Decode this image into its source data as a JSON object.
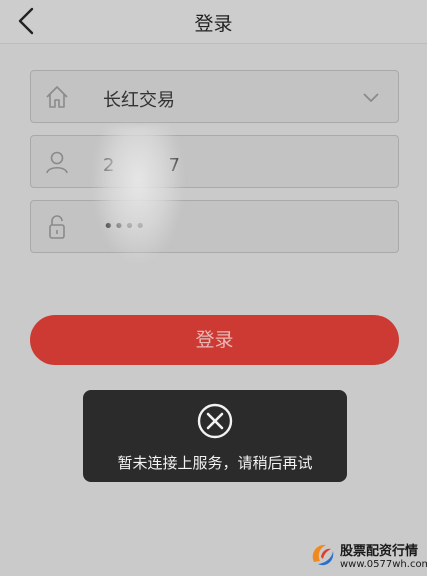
{
  "header": {
    "title": "登录"
  },
  "form": {
    "broker": {
      "value": "长红交易"
    },
    "account": {
      "value": "2　　　7"
    },
    "password": {
      "value": "••••"
    }
  },
  "login_button": {
    "label": "登录"
  },
  "toast": {
    "message": "暂未连接上服务，请稍后再试"
  },
  "watermark": {
    "title": "股票配资行情",
    "url": "www.0577wh.com"
  },
  "icons": {
    "back": "chevron-left-icon",
    "broker": "home-icon",
    "account": "user-icon",
    "password": "lock-icon",
    "dropdown": "chevron-down-icon",
    "error": "close-circle-icon"
  },
  "colors": {
    "primary_button": "#cc3a33",
    "toast_bg": "#2b2b2b"
  }
}
